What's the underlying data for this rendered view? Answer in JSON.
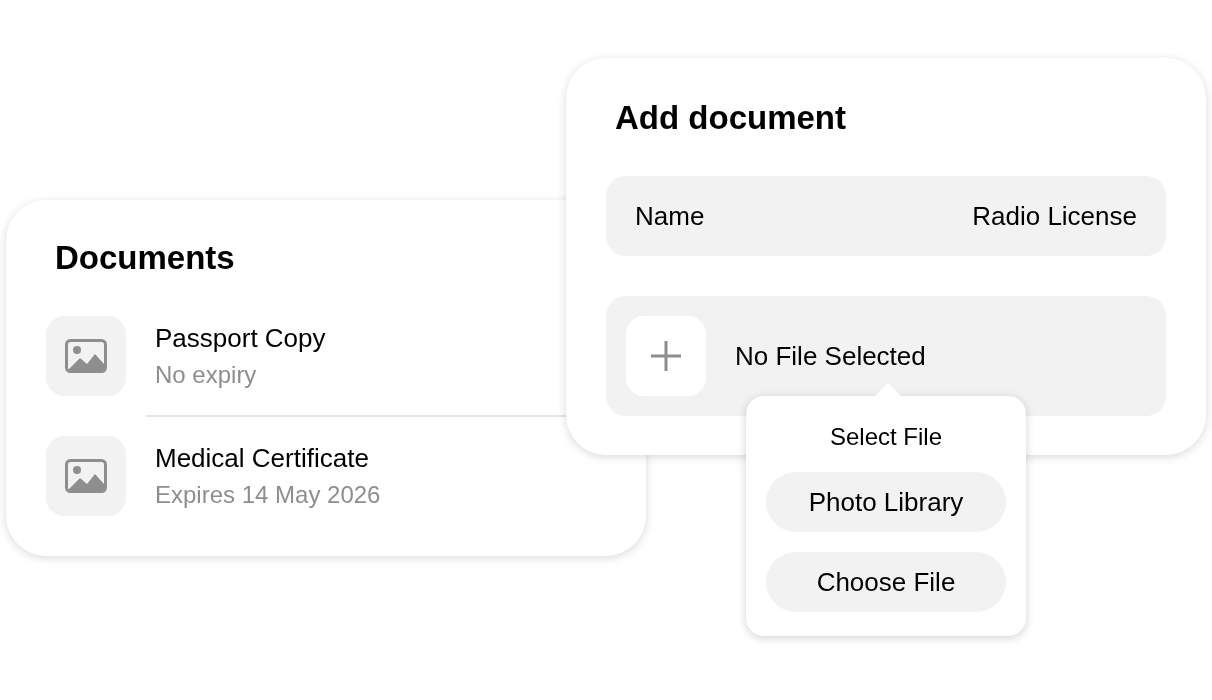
{
  "documents": {
    "title": "Documents",
    "items": [
      {
        "name": "Passport Copy",
        "detail": "No expiry"
      },
      {
        "name": "Medical Certificate",
        "detail": "Expires 14 May 2026"
      }
    ]
  },
  "add_document": {
    "title": "Add document",
    "name_field": {
      "label": "Name",
      "value": "Radio License"
    },
    "file": {
      "status": "No File Selected"
    }
  },
  "file_menu": {
    "title": "Select File",
    "options": [
      "Photo Library",
      "Choose File"
    ]
  }
}
